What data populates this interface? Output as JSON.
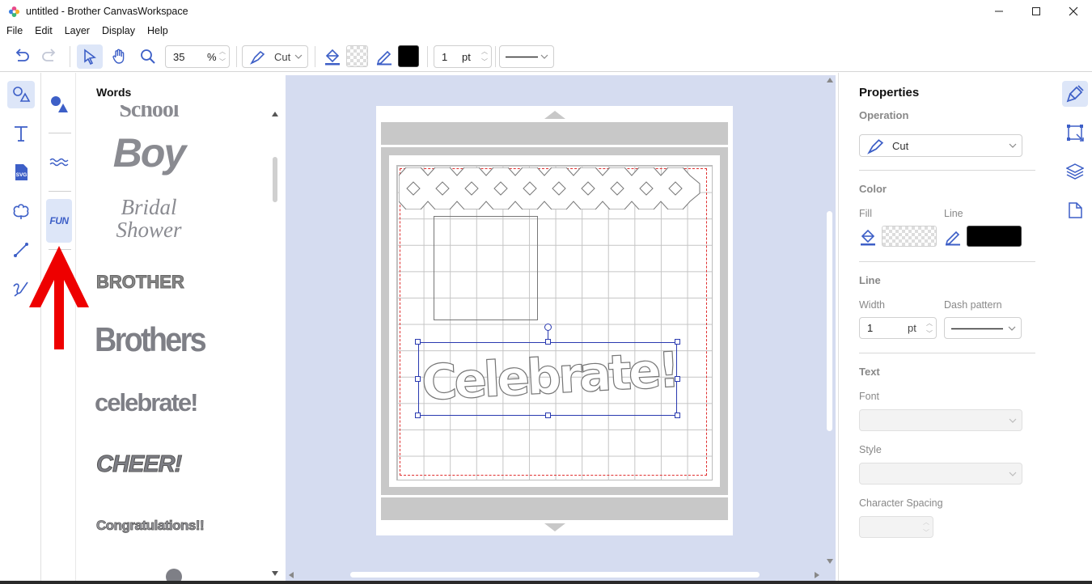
{
  "window": {
    "title": "untitled - Brother CanvasWorkspace"
  },
  "menu": [
    "File",
    "Edit",
    "Layer",
    "Display",
    "Help"
  ],
  "toolbar": {
    "zoom_value": "35",
    "zoom_unit": "%",
    "operation": "Cut",
    "line_width": "1",
    "line_unit": "pt"
  },
  "words_panel": {
    "title": "Words",
    "items": [
      "School",
      "Boy",
      "Bridal Shower",
      "BROTHER",
      "Brothers",
      "celebrate!",
      "CHEER!",
      "Congratulations!!"
    ]
  },
  "category": {
    "fun_label": "FUN"
  },
  "canvas": {
    "selected_text": "Celebrate!"
  },
  "properties": {
    "title": "Properties",
    "operation_label": "Operation",
    "operation_value": "Cut",
    "color_label": "Color",
    "fill_label": "Fill",
    "line_label": "Line",
    "line_section": "Line",
    "width_label": "Width",
    "width_value": "1",
    "width_unit": "pt",
    "dash_label": "Dash pattern",
    "text_section": "Text",
    "font_label": "Font",
    "style_label": "Style",
    "spacing_label": "Character Spacing",
    "line_color": "#000000",
    "accent_color": "#3d5fc7"
  }
}
